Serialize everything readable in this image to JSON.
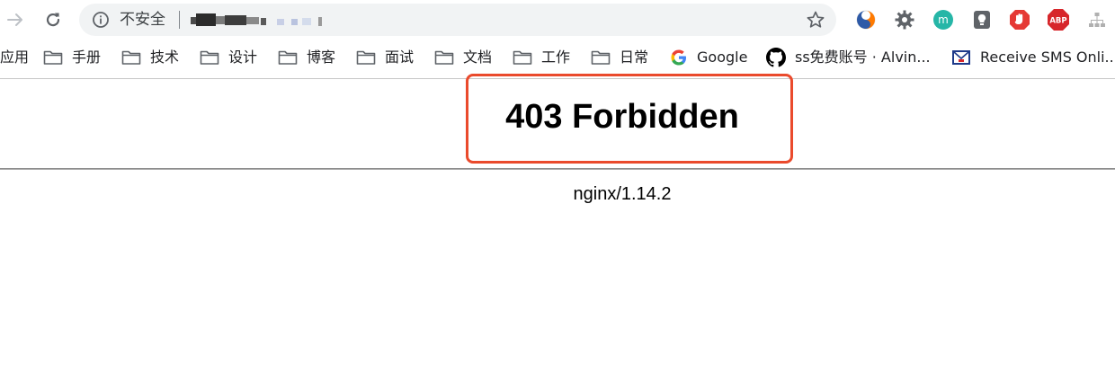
{
  "toolbar": {
    "security_label": "不安全",
    "url_masked": "",
    "extensions": [
      {
        "name": "sourcetree-icon",
        "color": "#ff7a00"
      },
      {
        "name": "gear-extension-icon",
        "color": "#5f6368"
      },
      {
        "name": "mercury-icon",
        "color": "#26b6a7"
      },
      {
        "name": "keep-icon",
        "color": "#5f6368"
      },
      {
        "name": "block-icon",
        "color": "#e53935"
      },
      {
        "name": "adblock-plus-icon",
        "color": "#d7262b",
        "text": "ABP"
      },
      {
        "name": "sitemap-icon",
        "color": "#b0b0b0"
      }
    ]
  },
  "bookmarks": {
    "apps_label": "应用",
    "folders": [
      "手册",
      "技术",
      "设计",
      "博客",
      "面试",
      "文档",
      "工作",
      "日常"
    ],
    "google_label": "Google",
    "github_label": "ss免费账号 · Alvin...",
    "sms_label": "Receive SMS Onli..."
  },
  "page": {
    "title": "403 Forbidden",
    "server": "nginx/1.14.2",
    "highlight_color": "#ea4a2c"
  }
}
